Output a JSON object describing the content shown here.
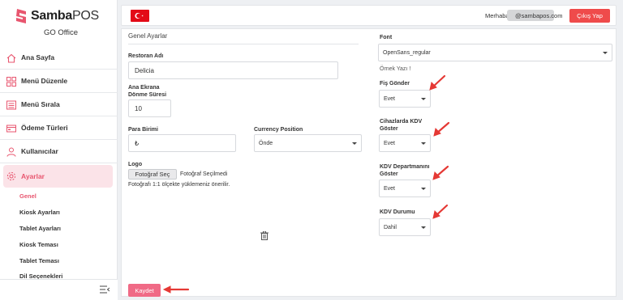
{
  "brand": {
    "name_main": "Samba",
    "name_suffix": "POS",
    "subtitle": "GO Office",
    "accent": "#e8566f"
  },
  "sidebar": {
    "items": [
      {
        "label": "Ana Sayfa",
        "icon": "home-icon"
      },
      {
        "label": "Menü Düzenle",
        "icon": "grid-icon"
      },
      {
        "label": "Menü Sırala",
        "icon": "list-icon"
      },
      {
        "label": "Ödeme Türleri",
        "icon": "payment-icon"
      },
      {
        "label": "Kullanıcılar",
        "icon": "user-icon"
      },
      {
        "label": "Ayarlar",
        "icon": "gear-icon",
        "active": true
      }
    ],
    "subitems": [
      {
        "label": "Genel",
        "active": true
      },
      {
        "label": "Kiosk Ayarları"
      },
      {
        "label": "Tablet Ayarları"
      },
      {
        "label": "Kiosk Teması"
      },
      {
        "label": "Tablet Teması"
      },
      {
        "label": "Dil Seçenekleri"
      }
    ]
  },
  "topbar": {
    "flag": "turkey-flag",
    "greeting": "Merhaba,",
    "email_domain": "@sambapos.com",
    "logout_label": "Çıkış Yap",
    "logout_color": "#ef4b4b"
  },
  "form": {
    "section_title": "Genel Ayarlar",
    "restaurant_name_label": "Restoran Adı",
    "restaurant_name_value": "Delicia",
    "rotation_label_line1": "Ana Ekrana",
    "rotation_label_line2": "Dönme Süresi",
    "rotation_value": "10",
    "currency_label": "Para Birimi",
    "currency_value": "₺",
    "currency_position_label": "Currency Position",
    "currency_position_value": "Önde",
    "logo_label": "Logo",
    "file_button_label": "Fotoğraf Seç",
    "file_status": "Fotoğraf Seçilmedi",
    "logo_hint": "Fotoğrafı 1:1 ölçekte yüklemeniz önerilir.",
    "font_label": "Font",
    "font_value": "OpenSans_regular",
    "sample_text": "Örnek Yazı !",
    "send_receipt_label": "Fiş Gönder",
    "send_receipt_value": "Evet",
    "show_on_device_label_line1": "Cihazlarda KDV",
    "show_on_device_label_line2": "Göster",
    "show_on_device_value": "Evet",
    "show_department_label_line1": "KDV Departmanını",
    "show_department_label_line2": "Göster",
    "show_department_value": "Evet",
    "tax_status_label": "KDV Durumu",
    "tax_status_value": "Dahil",
    "save_label": "Kaydet",
    "save_color": "#f06a86"
  },
  "annotations": {
    "arrow_color": "#e53935"
  }
}
